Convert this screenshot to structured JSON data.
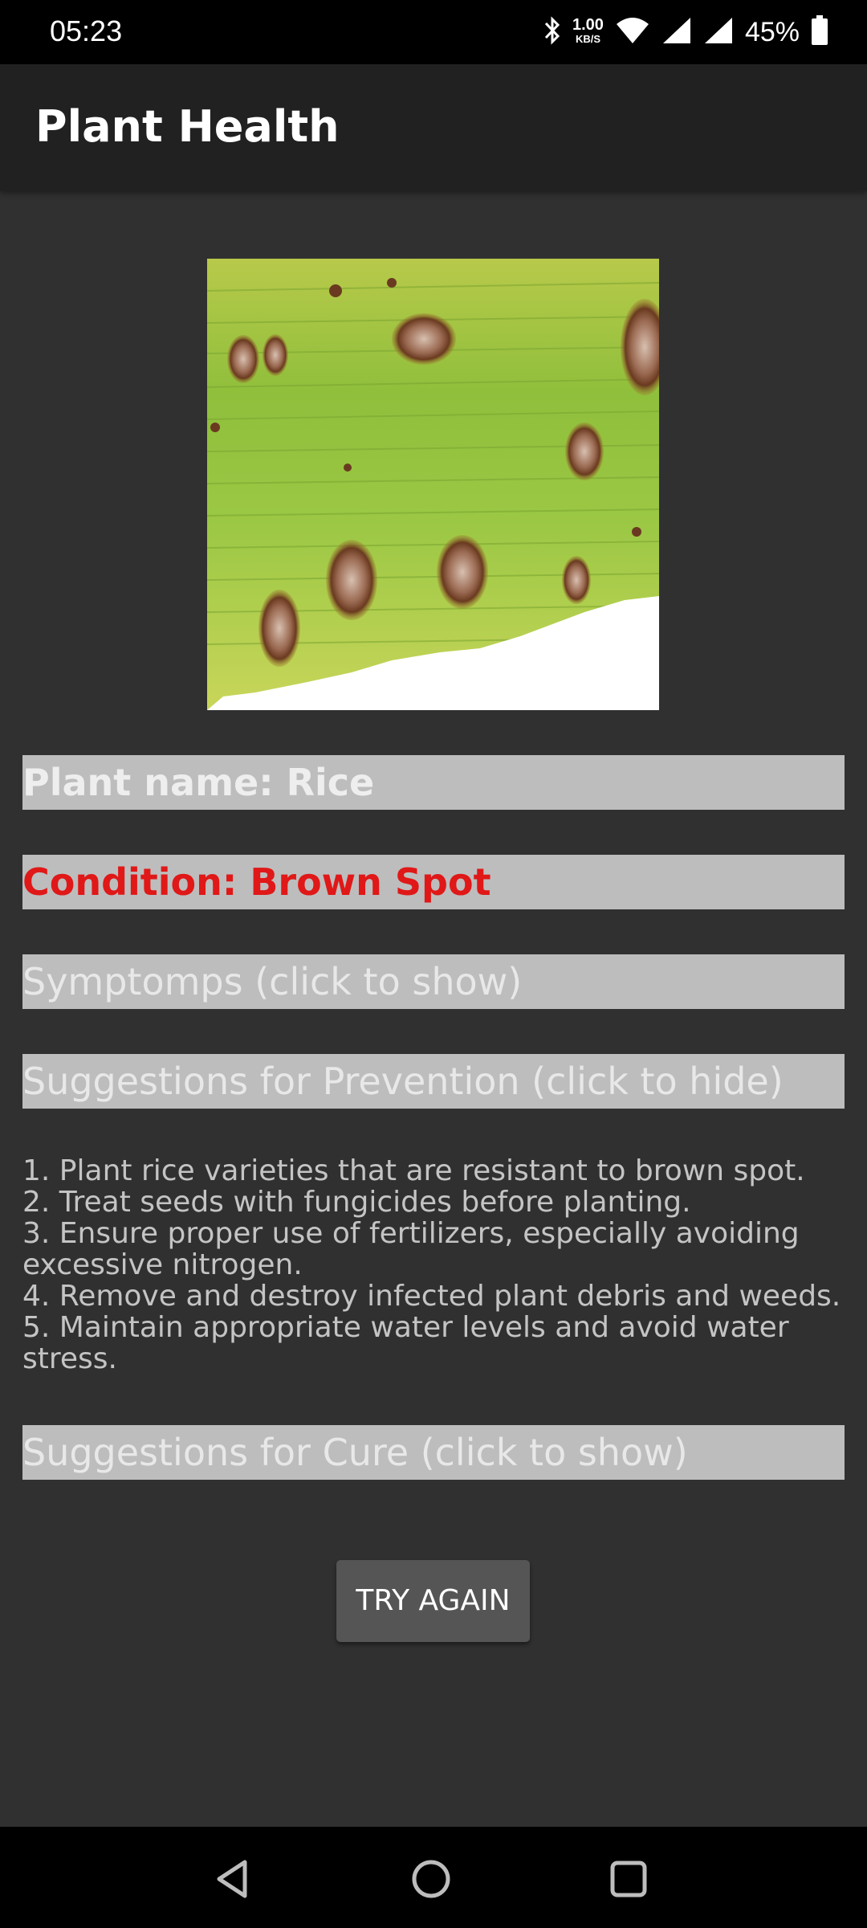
{
  "status_bar": {
    "time": "05:23",
    "net_speed_value": "1.00",
    "net_speed_unit": "KB/S",
    "battery": "45%",
    "icons": [
      "bluetooth-icon",
      "wifi-icon",
      "signal-icon",
      "signal-icon",
      "battery-icon"
    ]
  },
  "app_bar": {
    "title": "Plant Health"
  },
  "result": {
    "image": "leaf-photo",
    "plant_name": "Plant name: Rice",
    "condition": "Condition: Brown Spot",
    "condition_color": "#e01818",
    "symptoms_header": "Symptomps (click to show)",
    "prevention_header": "Suggestions for Prevention (click to hide)",
    "prevention_items": [
      "1. Plant rice varieties that are resistant to brown spot.",
      "2. Treat seeds with fungicides before planting.",
      "3. Ensure proper use of fertilizers, especially avoiding excessive nitrogen.",
      "4. Remove and destroy infected plant debris and weeds.",
      "5. Maintain appropriate water levels and avoid water stress."
    ],
    "cure_header": "Suggestions for Cure (click to show)"
  },
  "actions": {
    "try_again": "TRY AGAIN"
  },
  "nav_bar": {
    "icons": [
      "back-icon",
      "home-icon",
      "recents-icon"
    ]
  }
}
